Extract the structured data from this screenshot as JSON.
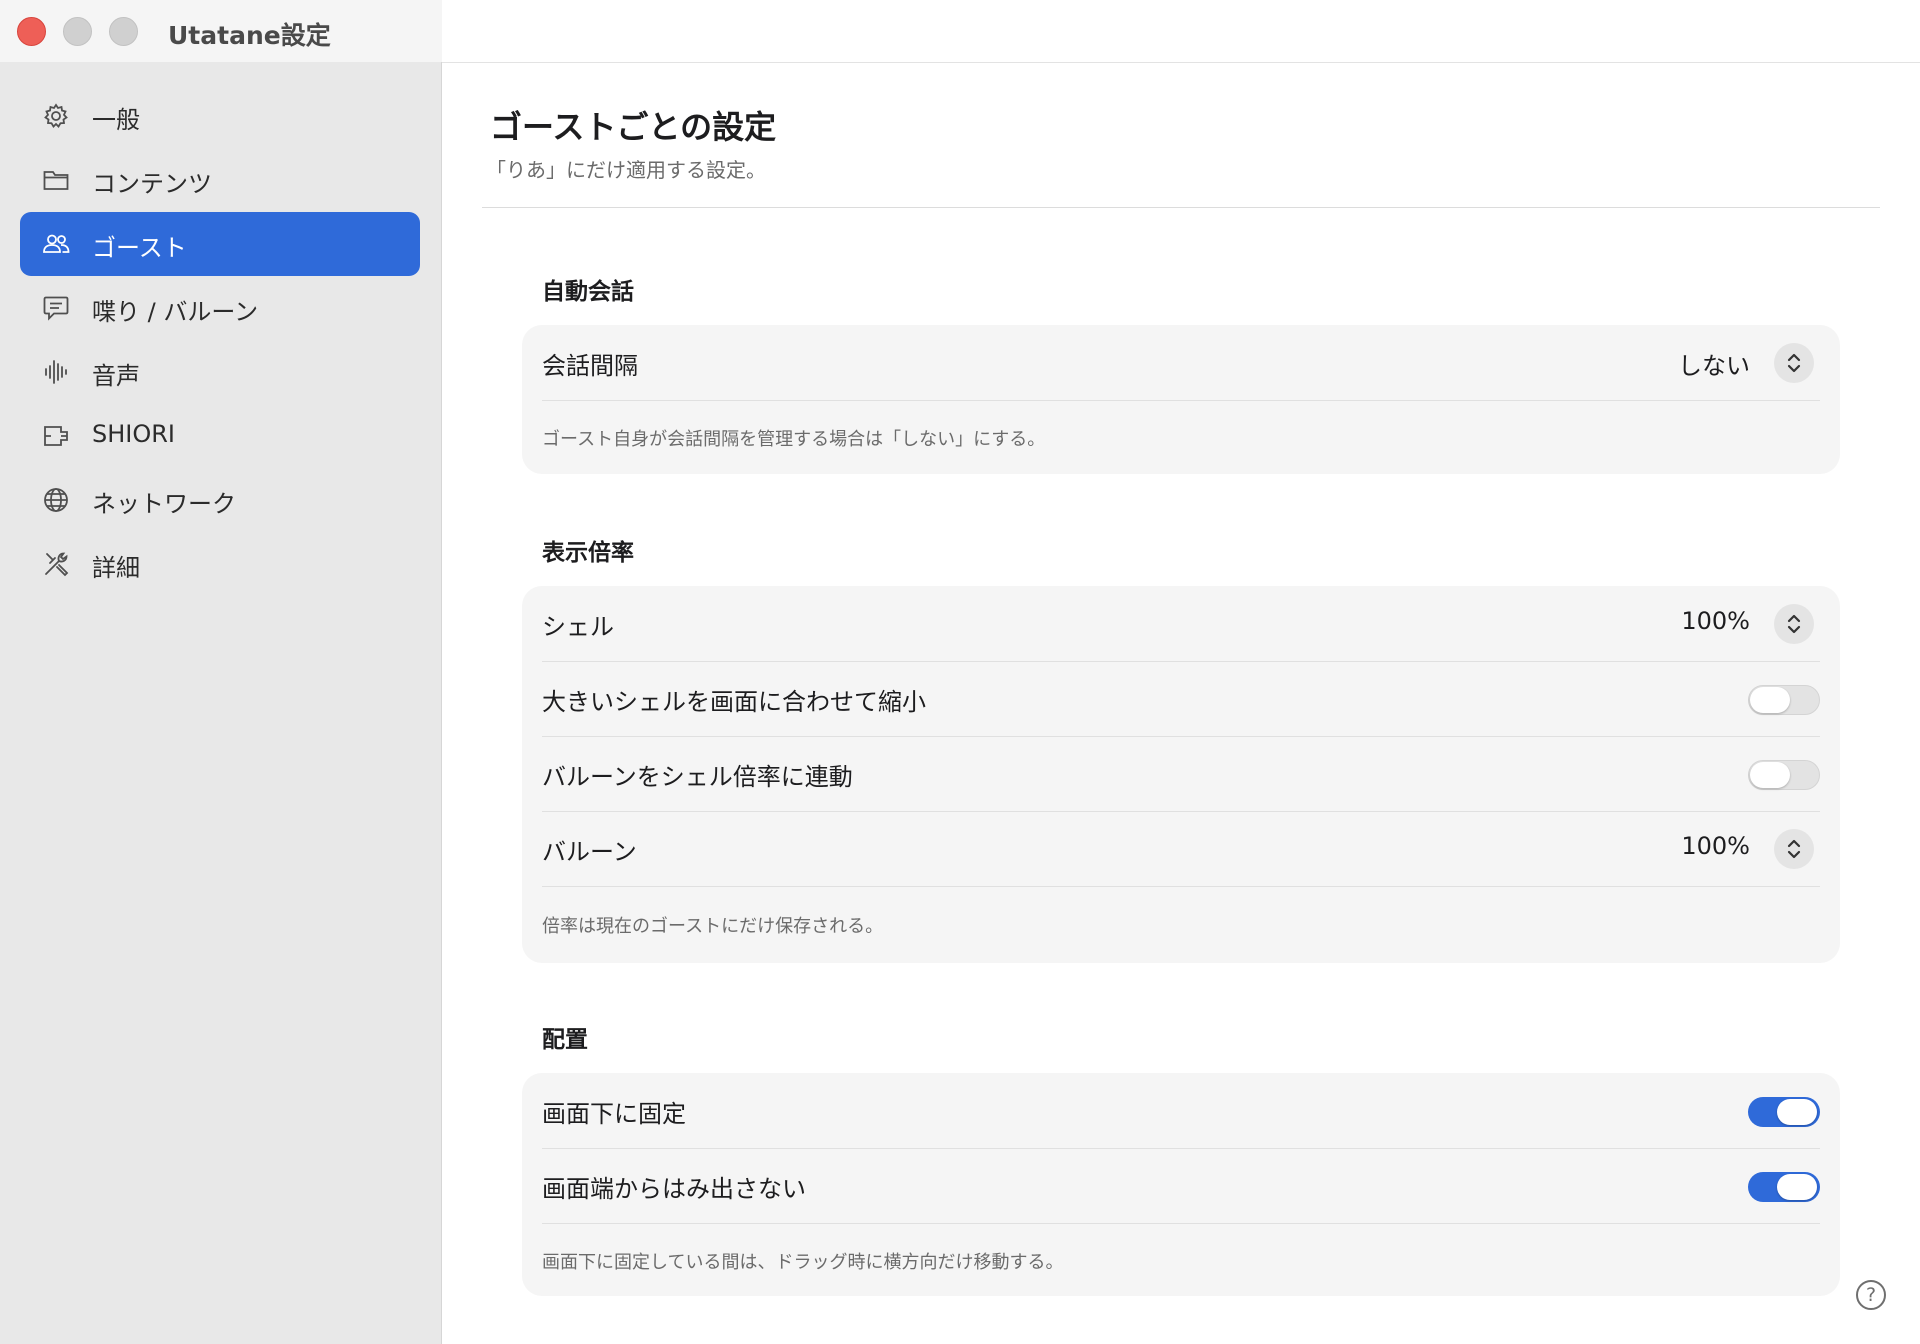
{
  "window": {
    "title": "Utatane設定"
  },
  "sidebar": {
    "items": [
      {
        "label": "一般",
        "icon": "gear-icon",
        "active": false
      },
      {
        "label": "コンテンツ",
        "icon": "folder-icon",
        "active": false
      },
      {
        "label": "ゴースト",
        "icon": "people-icon",
        "active": true
      },
      {
        "label": "喋り / バルーン",
        "icon": "speech-bubble-icon",
        "active": false
      },
      {
        "label": "音声",
        "icon": "waveform-icon",
        "active": false
      },
      {
        "label": "SHIORI",
        "icon": "plugin-icon",
        "active": false
      },
      {
        "label": "ネットワーク",
        "icon": "globe-icon",
        "active": false
      },
      {
        "label": "詳細",
        "icon": "tools-icon",
        "active": false
      }
    ]
  },
  "page": {
    "title": "ゴーストごとの設定",
    "subtitle": "「りあ」にだけ適用する設定。"
  },
  "sections": {
    "auto_talk": {
      "heading": "自動会話",
      "interval_label": "会話間隔",
      "interval_value": "しない",
      "note": "ゴースト自身が会話間隔を管理する場合は「しない」にする。"
    },
    "scale": {
      "heading": "表示倍率",
      "shell_label": "シェル",
      "shell_value": "100%",
      "shrink_label": "大きいシェルを画面に合わせて縮小",
      "shrink_on": false,
      "link_label": "バルーンをシェル倍率に連動",
      "link_on": false,
      "balloon_label": "バルーン",
      "balloon_value": "100%",
      "note": "倍率は現在のゴーストにだけ保存される。"
    },
    "placement": {
      "heading": "配置",
      "pin_bottom_label": "画面下に固定",
      "pin_bottom_on": true,
      "keep_inside_label": "画面端からはみ出さない",
      "keep_inside_on": true,
      "note": "画面下に固定している間は、ドラッグ時に横方向だけ移動する。"
    }
  },
  "help": {
    "label": "?"
  },
  "colors": {
    "accent": "#2f6ad9",
    "sidebar_bg": "#e8e8e8",
    "card_bg": "#f5f5f5",
    "close_button": "#ee5f57"
  }
}
